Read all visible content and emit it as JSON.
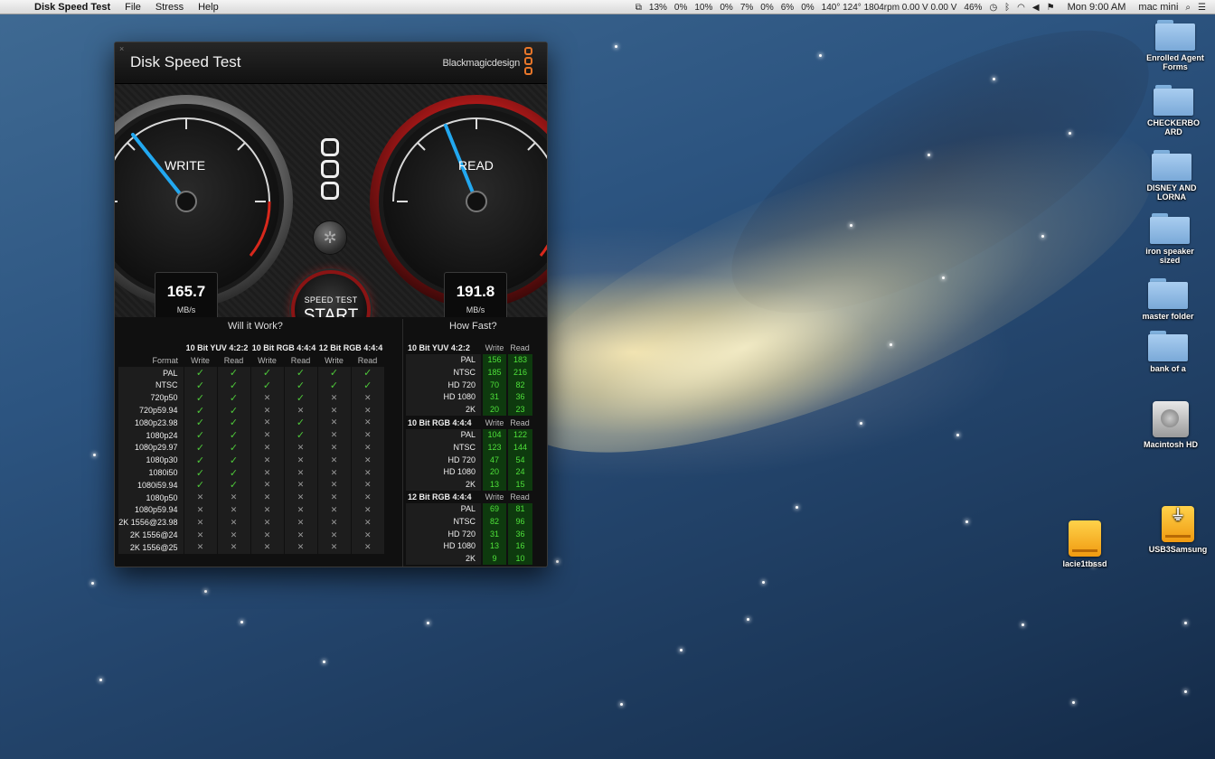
{
  "menubar": {
    "app_name": "Disk Speed Test",
    "items": [
      "File",
      "Stress",
      "Help"
    ],
    "status": [
      "13%",
      "0%",
      "10%",
      "0%",
      "7%",
      "0%",
      "6%",
      "0%",
      "140° 124° 1804rpm 0.00 V 0.00 V",
      "46%"
    ],
    "clock": "Mon 9:00 AM",
    "user": "mac mini"
  },
  "window": {
    "title": "Disk Speed Test",
    "brand": "Blackmagicdesign",
    "close": "×"
  },
  "gauges": {
    "write": {
      "label": "WRITE",
      "value": "165.7",
      "unit": "MB/s"
    },
    "read": {
      "label": "READ",
      "value": "191.8",
      "unit": "MB/s"
    }
  },
  "start_button": {
    "top": "SPEED TEST",
    "label": "START"
  },
  "will_it_work": {
    "title": "Will it Work?",
    "groups": [
      "10 Bit YUV 4:2:2",
      "10 Bit RGB 4:4:4",
      "12 Bit RGB 4:4:4"
    ],
    "format_header": "Format",
    "col_headers": [
      "Write",
      "Read",
      "Write",
      "Read",
      "Write",
      "Read"
    ],
    "rows": [
      {
        "format": "PAL",
        "marks": [
          1,
          1,
          1,
          1,
          1,
          1
        ]
      },
      {
        "format": "NTSC",
        "marks": [
          1,
          1,
          1,
          1,
          1,
          1
        ]
      },
      {
        "format": "720p50",
        "marks": [
          1,
          1,
          0,
          1,
          0,
          0
        ]
      },
      {
        "format": "720p59.94",
        "marks": [
          1,
          1,
          0,
          0,
          0,
          0
        ]
      },
      {
        "format": "1080p23.98",
        "marks": [
          1,
          1,
          0,
          1,
          0,
          0
        ]
      },
      {
        "format": "1080p24",
        "marks": [
          1,
          1,
          0,
          1,
          0,
          0
        ]
      },
      {
        "format": "1080p29.97",
        "marks": [
          1,
          1,
          0,
          0,
          0,
          0
        ]
      },
      {
        "format": "1080p30",
        "marks": [
          1,
          1,
          0,
          0,
          0,
          0
        ]
      },
      {
        "format": "1080i50",
        "marks": [
          1,
          1,
          0,
          0,
          0,
          0
        ]
      },
      {
        "format": "1080i59.94",
        "marks": [
          1,
          1,
          0,
          0,
          0,
          0
        ]
      },
      {
        "format": "1080p50",
        "marks": [
          0,
          0,
          0,
          0,
          0,
          0
        ]
      },
      {
        "format": "1080p59.94",
        "marks": [
          0,
          0,
          0,
          0,
          0,
          0
        ]
      },
      {
        "format": "2K 1556@23.98",
        "marks": [
          0,
          0,
          0,
          0,
          0,
          0
        ]
      },
      {
        "format": "2K 1556@24",
        "marks": [
          0,
          0,
          0,
          0,
          0,
          0
        ]
      },
      {
        "format": "2K 1556@25",
        "marks": [
          0,
          0,
          0,
          0,
          0,
          0
        ]
      }
    ]
  },
  "how_fast": {
    "title": "How Fast?",
    "col_headers": [
      "Write",
      "Read"
    ],
    "groups": [
      {
        "name": "10 Bit YUV 4:2:2",
        "rows": [
          {
            "format": "PAL",
            "write": "156",
            "read": "183"
          },
          {
            "format": "NTSC",
            "write": "185",
            "read": "216"
          },
          {
            "format": "HD 720",
            "write": "70",
            "read": "82"
          },
          {
            "format": "HD 1080",
            "write": "31",
            "read": "36"
          },
          {
            "format": "2K",
            "write": "20",
            "read": "23"
          }
        ]
      },
      {
        "name": "10 Bit RGB 4:4:4",
        "rows": [
          {
            "format": "PAL",
            "write": "104",
            "read": "122"
          },
          {
            "format": "NTSC",
            "write": "123",
            "read": "144"
          },
          {
            "format": "HD 720",
            "write": "47",
            "read": "54"
          },
          {
            "format": "HD 1080",
            "write": "20",
            "read": "24"
          },
          {
            "format": "2K",
            "write": "13",
            "read": "15"
          }
        ]
      },
      {
        "name": "12 Bit RGB 4:4:4",
        "rows": [
          {
            "format": "PAL",
            "write": "69",
            "read": "81"
          },
          {
            "format": "NTSC",
            "write": "82",
            "read": "96"
          },
          {
            "format": "HD 720",
            "write": "31",
            "read": "36"
          },
          {
            "format": "HD 1080",
            "write": "13",
            "read": "16"
          },
          {
            "format": "2K",
            "write": "9",
            "read": "10"
          }
        ]
      }
    ]
  },
  "desktop_icons": [
    {
      "label": "Enrolled Agent Forms",
      "type": "folder"
    },
    {
      "label": "CHECKERBOARD",
      "type": "folder"
    },
    {
      "label": "DISNEY AND LORNA",
      "type": "folder"
    },
    {
      "label": "iron speaker sized",
      "type": "folder"
    },
    {
      "label": "master folder",
      "type": "folder"
    },
    {
      "label": "bank of a",
      "type": "folder"
    },
    {
      "label": "Macintosh HD",
      "type": "internal-drive"
    },
    {
      "label": "lacie1tbssd",
      "type": "external-drive"
    },
    {
      "label": "USB3Samsung",
      "type": "usb-drive"
    }
  ]
}
